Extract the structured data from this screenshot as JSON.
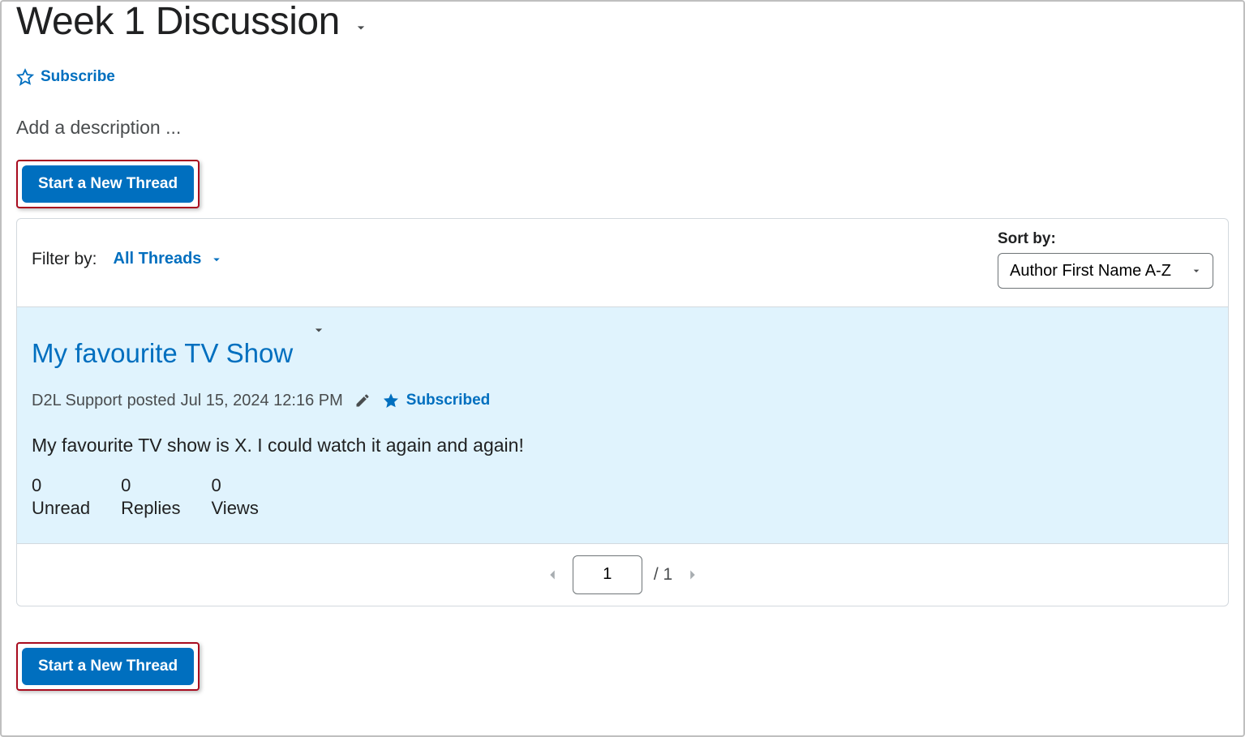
{
  "page": {
    "title": "Week 1 Discussion",
    "subscribe_label": "Subscribe",
    "description_placeholder": "Add a description ..."
  },
  "actions": {
    "new_thread_label": "Start a New Thread"
  },
  "filter": {
    "label": "Filter by:",
    "value": "All Threads"
  },
  "sort": {
    "label": "Sort by:",
    "value": "Author First Name A-Z"
  },
  "thread": {
    "title": "My favourite TV Show",
    "author": "D2L Support",
    "posted_verb": "posted",
    "posted_at": "Jul 15, 2024 12:16 PM",
    "subscribed_label": "Subscribed",
    "body": "My favourite TV show is X. I could watch it again and again!",
    "stats": {
      "unread": {
        "count": "0",
        "label": "Unread"
      },
      "replies": {
        "count": "0",
        "label": "Replies"
      },
      "views": {
        "count": "0",
        "label": "Views"
      }
    }
  },
  "pagination": {
    "current": "1",
    "total": "1",
    "separator": "/"
  }
}
